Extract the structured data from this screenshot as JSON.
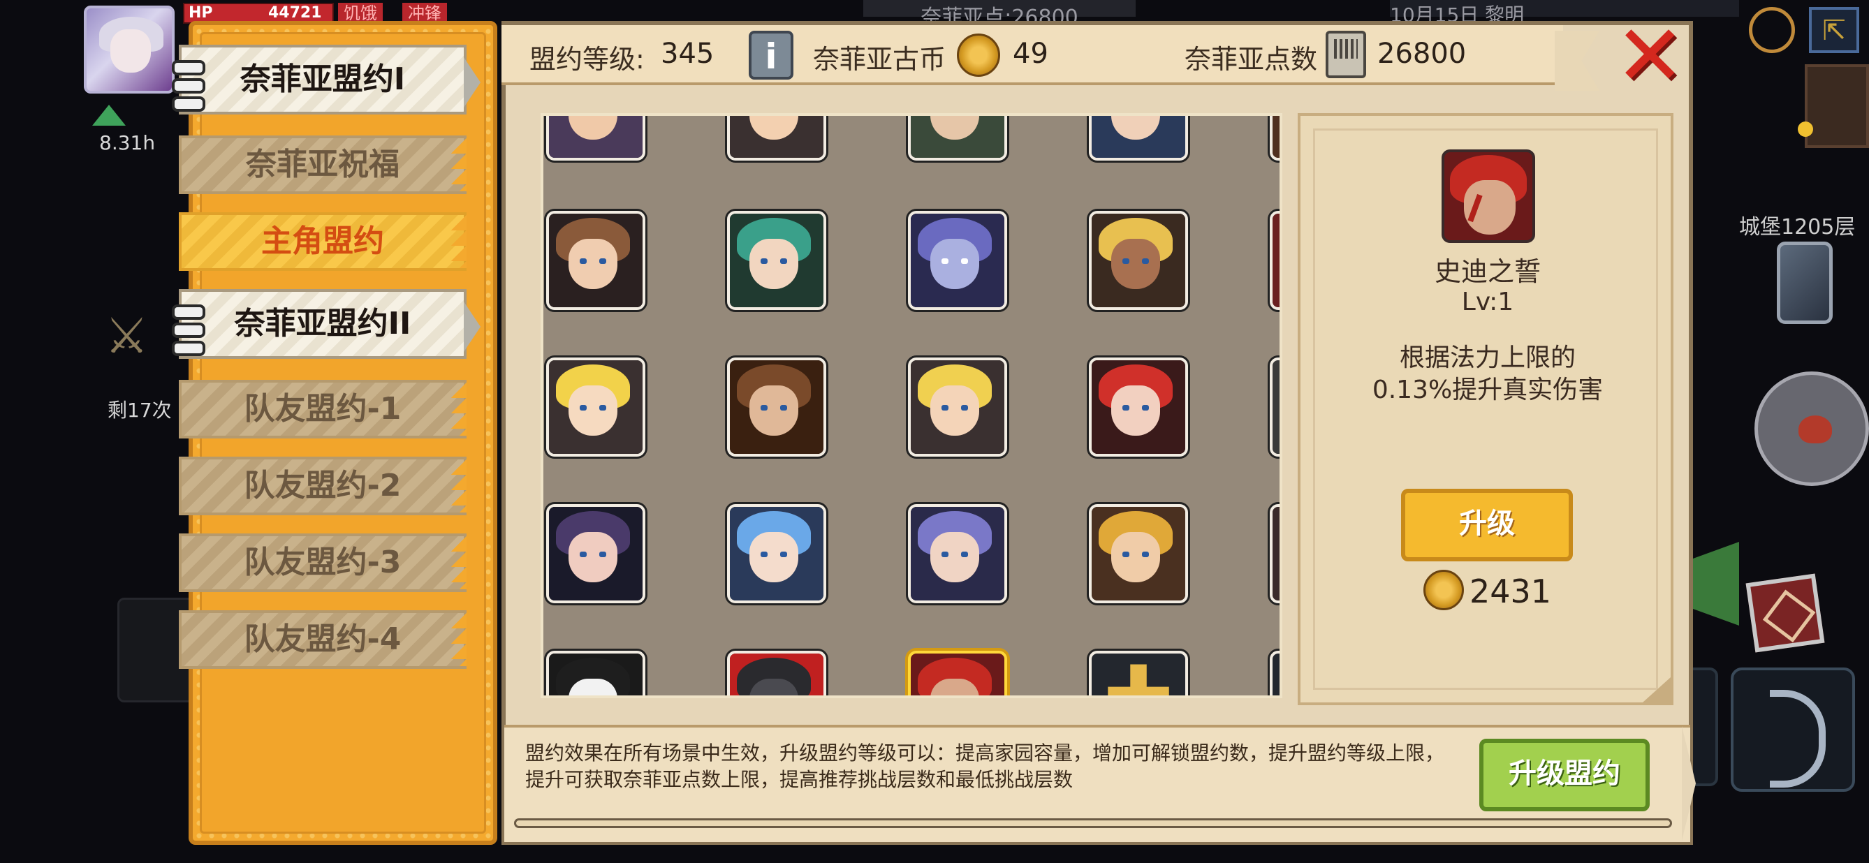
{
  "hud": {
    "hp_label": "HP",
    "hp_value": "44721",
    "btn1": "饥饿",
    "btn2": "冲锋",
    "boost_time": "8.31h",
    "remaining": "剩17次",
    "floor": "城堡1205层",
    "top_center_blur": "奈菲亚点:26800",
    "top_right_blur": "10月15日 黎明"
  },
  "tabs": [
    {
      "label": "奈菲亚盟约I",
      "state": "active"
    },
    {
      "label": "奈菲亚祝福",
      "state": "normal"
    },
    {
      "label": "主角盟约",
      "state": "highlight"
    },
    {
      "label": "奈菲亚盟约II",
      "state": "active"
    },
    {
      "label": "队友盟约-1",
      "state": "normal"
    },
    {
      "label": "队友盟约-2",
      "state": "normal"
    },
    {
      "label": "队友盟约-3",
      "state": "normal"
    },
    {
      "label": "队友盟约-4",
      "state": "normal"
    }
  ],
  "header": {
    "level_label": "盟约等级:",
    "level_value": "345",
    "coin_label": "奈菲亚古币",
    "coin_value": "49",
    "points_label": "奈菲亚点数",
    "points_value": "26800"
  },
  "portraits": [
    [
      "blonde-elf",
      "blonde-girl",
      "green-hair-elf",
      "blue-hair-elf",
      "bearded-dwarf"
    ],
    [
      "brown-hair-girl",
      "teal-curly-hair",
      "pale-elf",
      "dark-blonde-girl",
      "orange-hair-demon"
    ],
    [
      "blonde-twin",
      "brown-hooded",
      "blonde-elf-2",
      "red-hair-girl",
      "gray-hair-man"
    ],
    [
      "purple-hair-girl",
      "blue-cat-girl",
      "lavender-elf",
      "golden-hair-girl",
      "blue-hair-knight"
    ],
    [
      "masked-ghost",
      "dark-armor",
      "red-hair-warrior",
      "add-slot",
      "locked-slot"
    ]
  ],
  "detail": {
    "name": "史迪之誓",
    "level": "Lv:1",
    "desc_line1": "根据法力上限的",
    "desc_line2": "0.13%提升真实伤害",
    "upgrade_label": "升级",
    "cost": "2431"
  },
  "footer": {
    "description_line1": "盟约效果在所有场景中生效，升级盟约等级可以：提高家园容量，增加可解锁盟约数，提升盟约等级上限，",
    "description_line2": "提升可获取奈菲亚点数上限，提高推荐挑战层数和最低挑战层数",
    "upgrade_league_label": "升级盟约"
  },
  "colors": {
    "tab_panel": "#f4a92e",
    "highlight_text": "#d44d12",
    "upgrade_button": "#f5ba2e",
    "league_button": "#a2d04e",
    "close": "#d4281e"
  }
}
